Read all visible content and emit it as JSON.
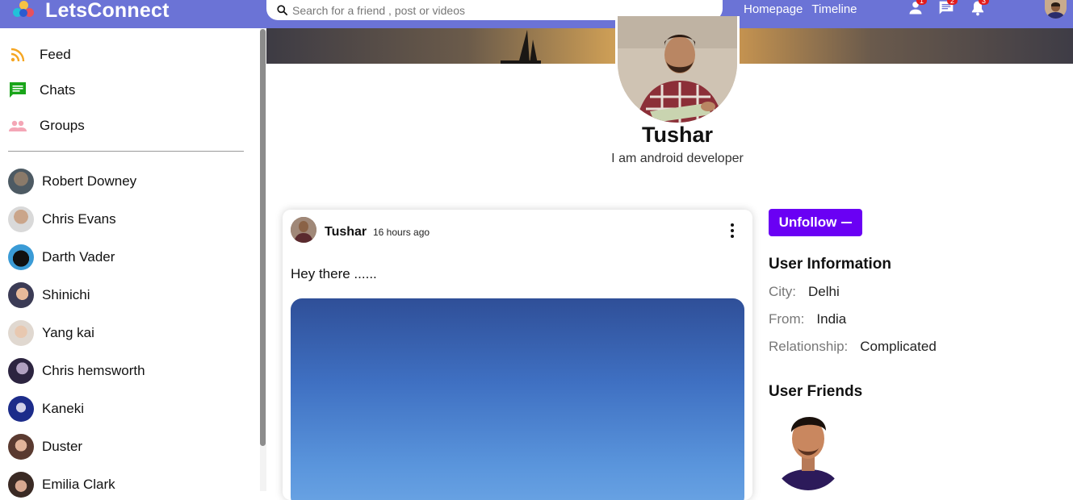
{
  "app": {
    "name": "LetsConnect"
  },
  "search": {
    "placeholder": "Search for a friend , post or videos"
  },
  "topnav": {
    "links": [
      "Homepage",
      "Timeline"
    ],
    "icons": [
      {
        "name": "person-icon",
        "badge": "1"
      },
      {
        "name": "chat-icon",
        "badge": "2"
      },
      {
        "name": "notifications-icon",
        "badge": "3"
      }
    ]
  },
  "sidebar": {
    "menu": [
      {
        "label": "Feed",
        "icon": "rss-icon",
        "color": "#f5a623"
      },
      {
        "label": "Chats",
        "icon": "chat-icon",
        "color": "#1aa51a"
      },
      {
        "label": "Groups",
        "icon": "groups-icon",
        "color": "#f4a6b6"
      }
    ],
    "friends": [
      {
        "name": "Robert Downey"
      },
      {
        "name": "Chris Evans"
      },
      {
        "name": "Darth Vader"
      },
      {
        "name": "Shinichi"
      },
      {
        "name": "Yang kai"
      },
      {
        "name": "Chris hemsworth"
      },
      {
        "name": "Kaneki"
      },
      {
        "name": "Duster"
      },
      {
        "name": "Emilia Clark"
      }
    ]
  },
  "profile": {
    "name": "Tushar",
    "description": "I am android developer"
  },
  "post": {
    "user": "Tushar",
    "time": "16 hours ago",
    "text": "Hey there ......"
  },
  "actions": {
    "follow_label": "Unfollow"
  },
  "info": {
    "title": "User Information",
    "rows": [
      {
        "key": "City:",
        "value": "Delhi"
      },
      {
        "key": "From:",
        "value": "India"
      },
      {
        "key": "Relationship:",
        "value": "Complicated"
      }
    ],
    "friends_title": "User Friends"
  },
  "colors": {
    "topbar": "#6b73d6",
    "accent": "#6a00f4",
    "badge": "#e31b1b"
  }
}
